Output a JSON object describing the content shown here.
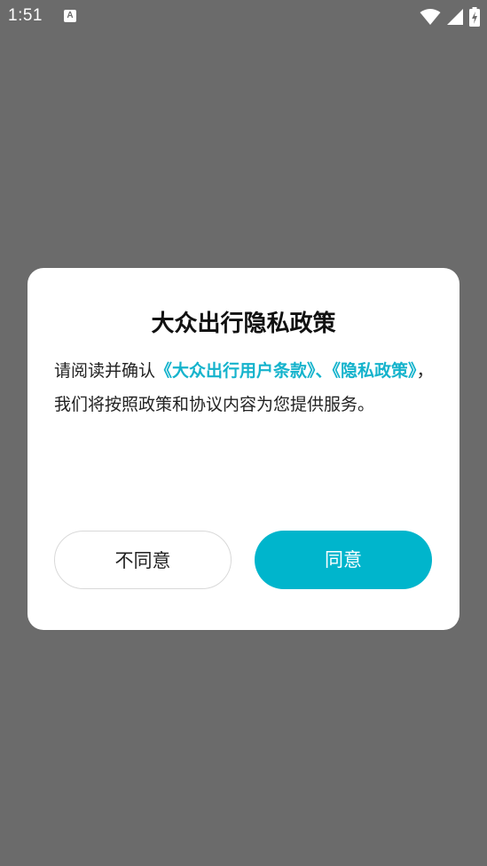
{
  "status_bar": {
    "time": "1:51",
    "notification_glyph": "A",
    "icons": [
      "wifi-icon",
      "signal-icon",
      "battery-charging-icon"
    ]
  },
  "dialog": {
    "title": "大众出行隐私政策",
    "body_prefix": "请阅读并确认",
    "link_terms": "《大众出行用户条款》",
    "separator": "、",
    "link_privacy": "《隐私政策》",
    "body_suffix": "，我们将按照政策和协议内容为您提供服务。",
    "disagree_label": "不同意",
    "agree_label": "同意"
  },
  "colors": {
    "backdrop": "#6b6b6b",
    "accent": "#00b5cc",
    "link": "#15b3cc"
  }
}
